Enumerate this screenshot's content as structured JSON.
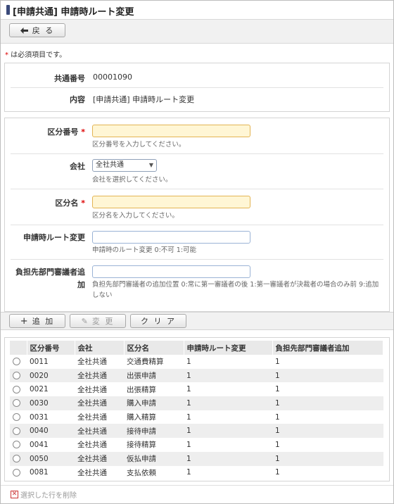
{
  "page": {
    "title": "[申請共通] 申請時ルート変更",
    "back_label": "戻 る",
    "required_note_star": "*",
    "required_note": " は必須項目です。"
  },
  "info": {
    "common_no_label": "共通番号",
    "common_no_value": "00001090",
    "content_label": "内容",
    "content_value": "[申請共通] 申請時ルート変更"
  },
  "form": {
    "division_no": {
      "label": "区分番号",
      "star": "*",
      "value": "",
      "hint": "区分番号を入力してください。"
    },
    "company": {
      "label": "会社",
      "value": "全社共通",
      "hint": "会社を選択してください。"
    },
    "division_name": {
      "label": "区分名",
      "star": "*",
      "value": "",
      "hint": "区分名を入力してください。"
    },
    "route_change": {
      "label": "申請時ルート変更",
      "value": "",
      "hint": "申請時のルート変更 0:不可 1:可能"
    },
    "burden_dept": {
      "label_line1": "負担先部門審議者追",
      "label_line2": "加",
      "value": "",
      "hint": "負担先部門審議者の追加位置 0:常に第一審議者の後 1:第一審議者が決裁者の場合のみ前 9:追加しない"
    }
  },
  "actions": {
    "add_label": "追 加",
    "edit_label": "変 更",
    "clear_label": "ク リ ア"
  },
  "table": {
    "headers": [
      "区分番号",
      "会社",
      "区分名",
      "申請時ルート変更",
      "負担先部門審議者追加"
    ],
    "rows": [
      [
        "0011",
        "全社共通",
        "交通費精算",
        "1",
        "1"
      ],
      [
        "0020",
        "全社共通",
        "出張申請",
        "1",
        "1"
      ],
      [
        "0021",
        "全社共通",
        "出張精算",
        "1",
        "1"
      ],
      [
        "0030",
        "全社共通",
        "購入申請",
        "1",
        "1"
      ],
      [
        "0031",
        "全社共通",
        "購入精算",
        "1",
        "1"
      ],
      [
        "0040",
        "全社共通",
        "接待申請",
        "1",
        "1"
      ],
      [
        "0041",
        "全社共通",
        "接待精算",
        "1",
        "1"
      ],
      [
        "0050",
        "全社共通",
        "仮払申請",
        "1",
        "1"
      ],
      [
        "0081",
        "全社共通",
        "支払依頼",
        "1",
        "1"
      ]
    ]
  },
  "footer": {
    "delete_label": "選択した行を削除"
  }
}
